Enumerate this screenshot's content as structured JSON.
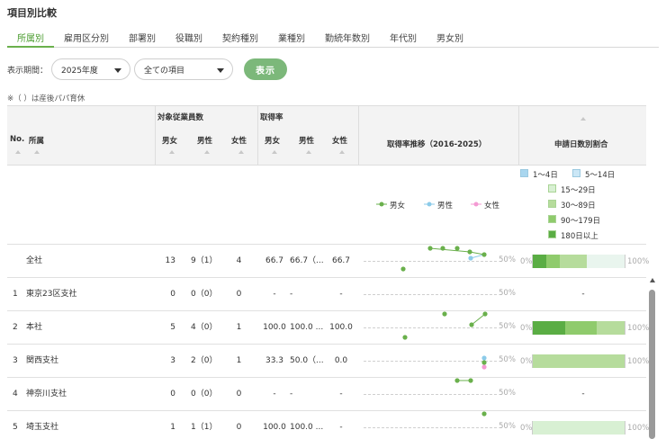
{
  "title": "項目別比較",
  "tabs": [
    {
      "label": "所属別",
      "active": true
    },
    {
      "label": "雇用区分別",
      "active": false
    },
    {
      "label": "部署別",
      "active": false
    },
    {
      "label": "役職別",
      "active": false
    },
    {
      "label": "契約種別",
      "active": false
    },
    {
      "label": "業種別",
      "active": false
    },
    {
      "label": "勤続年数別",
      "active": false
    },
    {
      "label": "年代別",
      "active": false
    },
    {
      "label": "男女別",
      "active": false
    }
  ],
  "filters": {
    "period_label": "表示期間：",
    "year_value": "2025年度",
    "item_value": "全ての項目",
    "show_button": "表示"
  },
  "note": "※（ ）は産後パパ育休",
  "header": {
    "no": "No.",
    "dept": "所属",
    "target_group": "対象従業員数",
    "rate_group": "取得率",
    "both": "男女",
    "male": "男性",
    "female": "女性",
    "trend": "取得率推移（2016-2025）",
    "ratio": "申請日数別割合"
  },
  "trend_legend": {
    "both": "男女",
    "male": "男性",
    "female": "女性"
  },
  "ratio_legend": [
    {
      "label": "1〜4日",
      "color": "#a9d6ef"
    },
    {
      "label": "5〜14日",
      "color": "#cbe7f6"
    },
    {
      "label": "15〜29日",
      "color": "#d8f0d3"
    },
    {
      "label": "30〜89日",
      "color": "#b6dc9c"
    },
    {
      "label": "90〜179日",
      "color": "#8fcb6c"
    },
    {
      "label": "180日以上",
      "color": "#5aad44"
    }
  ],
  "axis": {
    "mid": "50%",
    "min": "0%",
    "max": "100%"
  },
  "colors": {
    "accent": "#6ab04c",
    "both": "#6ab04c",
    "male": "#8ccbe9",
    "female": "#f49ad3"
  },
  "rows": [
    {
      "no": "",
      "dept": "全社",
      "t_both": "13",
      "t_male": "9（1）",
      "t_female": "4",
      "r_both": "66.7",
      "r_male": "66.7（...",
      "r_female": "66.7",
      "trend": {
        "both": [
          null,
          null,
          null,
          null,
          null,
          null,
          5,
          91,
          91,
          91,
          91,
          83
        ],
        "male": [],
        "female": []
      },
      "ratio": [
        0,
        0,
        0,
        0.3,
        0.14,
        0.15
      ],
      "empty_ratio": ""
    },
    {
      "no": "1",
      "dept": "東京23区支社",
      "t_both": "0",
      "t_male": "0（0）",
      "t_female": "0",
      "r_both": "-",
      "r_male": "-",
      "r_female": "-",
      "trend": null,
      "ratio": null,
      "empty_ratio": "-"
    },
    {
      "no": "2",
      "dept": "本社",
      "t_both": "5",
      "t_male": "4（0）",
      "t_female": "1",
      "r_both": "100.0",
      "r_male": "100.0 ...",
      "r_female": "100.0",
      "trend": {
        "both": [],
        "male": [],
        "female": []
      },
      "ratio": [
        0,
        0,
        0,
        0.3,
        0.35,
        0.35
      ],
      "empty_ratio": ""
    },
    {
      "no": "3",
      "dept": "関西支社",
      "t_both": "3",
      "t_male": "2（0）",
      "t_female": "1",
      "r_both": "33.3",
      "r_male": "50.0（...",
      "r_female": "0.0",
      "trend": {
        "both": [],
        "male": [],
        "female": []
      },
      "ratio": [
        0,
        0,
        0,
        1.0,
        0,
        0
      ],
      "empty_ratio": ""
    },
    {
      "no": "4",
      "dept": "神奈川支社",
      "t_both": "0",
      "t_male": "0（0）",
      "t_female": "0",
      "r_both": "-",
      "r_male": "-",
      "r_female": "-",
      "trend": {
        "both": [],
        "male": [],
        "female": []
      },
      "ratio": null,
      "empty_ratio": "-"
    },
    {
      "no": "5",
      "dept": "埼玉支社",
      "t_both": "1",
      "t_male": "1（1）",
      "t_female": "0",
      "r_both": "100.0",
      "r_male": "100.0 ...",
      "r_female": "-",
      "trend": {
        "both": [],
        "male": [],
        "female": []
      },
      "ratio": [
        0,
        0,
        1.0,
        0,
        0,
        0
      ],
      "empty_ratio": ""
    }
  ]
}
